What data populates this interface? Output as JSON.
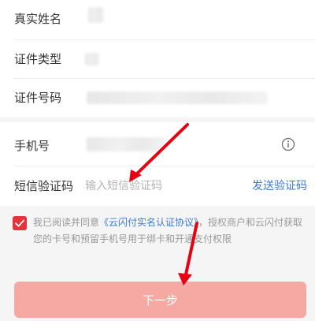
{
  "identity": {
    "name_label": "真实姓名",
    "id_type_label": "证件类型",
    "id_number_label": "证件号码"
  },
  "phone": {
    "phone_label": "手机号",
    "sms_label": "短信验证码",
    "sms_placeholder": "输入短信验证码",
    "send_code_label": "发送验证码"
  },
  "agreement": {
    "checked": true,
    "text_before": "我已阅读并同意",
    "link_text": "《云闪付实名认证协议》",
    "text_after": "，授权商户和云闪付获取您的卡号和预留手机号用于绑卡和开通支付权限"
  },
  "next_button_label": "下一步",
  "colors": {
    "accent_red": "#e6323a",
    "link_blue": "#3a7bd5",
    "button_disabled": "#f6a8a2"
  },
  "icons": [
    "info-icon",
    "checkmark-icon",
    "arrow-annotation"
  ]
}
